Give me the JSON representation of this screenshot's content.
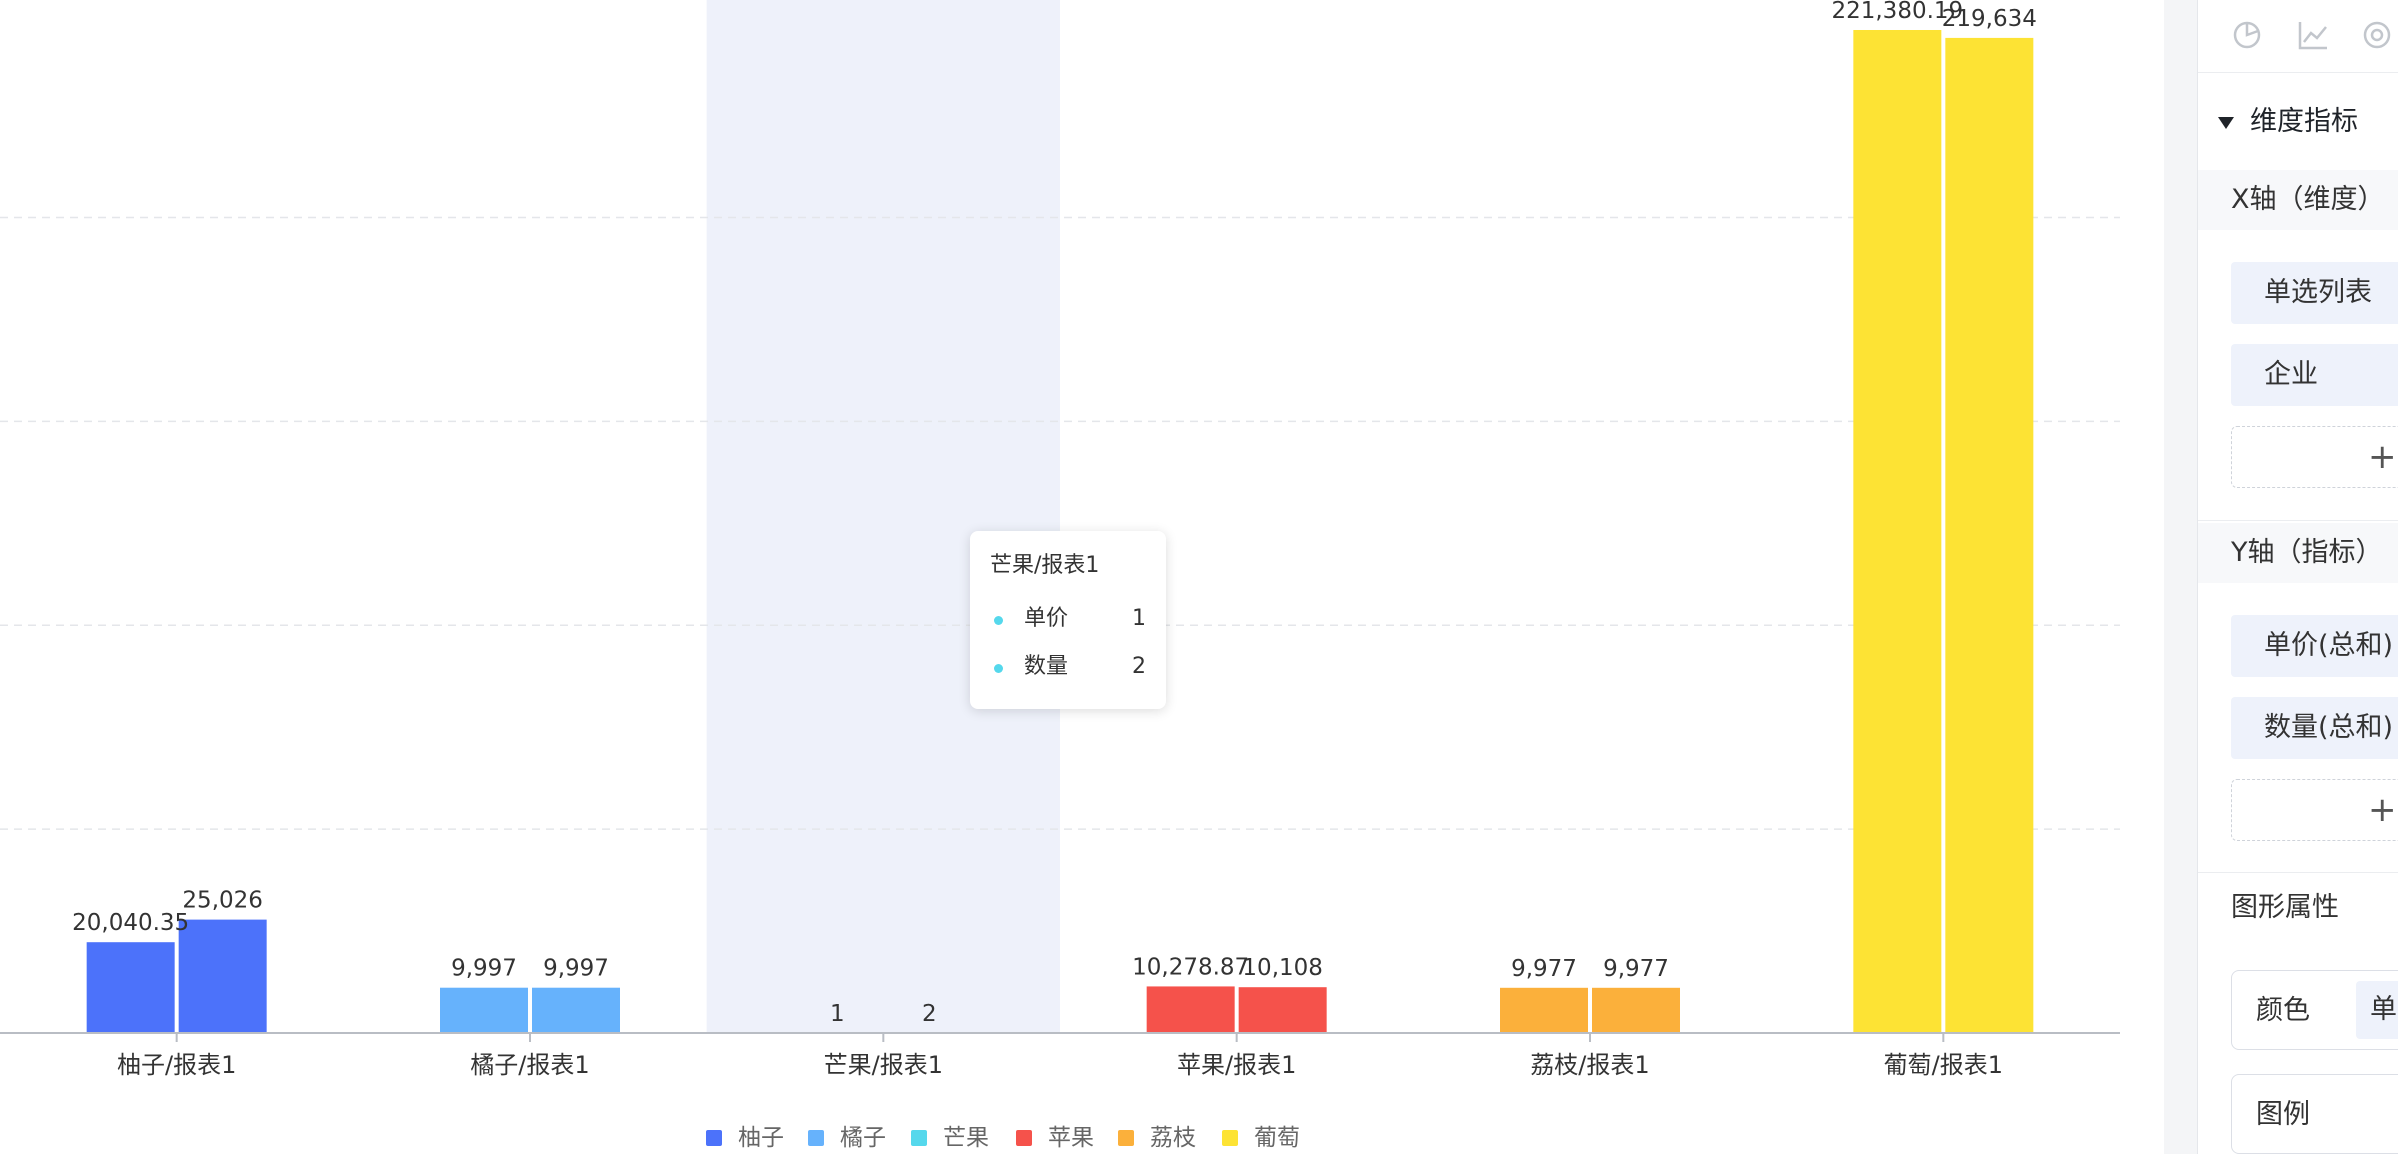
{
  "chart_data": {
    "type": "bar",
    "categories": [
      "柚子/报表1",
      "橘子/报表1",
      "芒果/报表1",
      "苹果/报表1",
      "荔枝/报表1",
      "葡萄/报表1"
    ],
    "series": [
      {
        "name": "单价",
        "values": [
          20040.35,
          9997,
          1,
          10278.87,
          9977,
          221380.19
        ]
      },
      {
        "name": "数量",
        "values": [
          25026,
          9997,
          2,
          10108,
          9977,
          219634
        ]
      }
    ],
    "value_labels": [
      [
        "20,040.35",
        "9,997",
        "1",
        "10,278.87",
        "9,977",
        "221,380.19"
      ],
      [
        "25,026",
        "9,997",
        "2",
        "10,108",
        "9,977",
        "219,634"
      ]
    ],
    "category_colors": [
      "#4c72fa",
      "#66b2fc",
      "#55d8ec",
      "#f5524b",
      "#fbb03b",
      "#fde334"
    ],
    "ylim": [
      0,
      228000
    ],
    "grid": true,
    "highlight_category": "芒果/报表1",
    "highlight_color": "#eef1fa",
    "axis_color": "#b9bdc4",
    "grid_color": "#e4e6ea",
    "legend_position": "bottom-center",
    "legend": [
      {
        "label": "柚子",
        "color": "#4c72fa"
      },
      {
        "label": "橘子",
        "color": "#66b2fc"
      },
      {
        "label": "芒果",
        "color": "#55d8ec"
      },
      {
        "label": "苹果",
        "color": "#f5524b"
      },
      {
        "label": "荔枝",
        "color": "#fbb03b"
      },
      {
        "label": "葡萄",
        "color": "#fde334"
      }
    ]
  },
  "tooltip": {
    "title": "芒果/报表1",
    "dot_color": "#55d8ec",
    "rows": [
      {
        "label": "单价",
        "value": "1"
      },
      {
        "label": "数量",
        "value": "2"
      }
    ]
  },
  "panel": {
    "toolbar_icons": [
      "pie-chart-icon",
      "line-chart-icon",
      "donut-chart-icon"
    ],
    "section_title": "维度指标",
    "x_axis": {
      "title": "X轴（维度）",
      "fields": [
        "单选列表",
        "企业"
      ],
      "add_symbol": "+"
    },
    "y_axis": {
      "title": "Y轴（指标）",
      "fields": [
        "单价(总和)",
        "数量(总和)"
      ],
      "add_symbol": "+"
    },
    "graph_props": {
      "title": "图形属性",
      "color_label": "颜色",
      "color_value": "单",
      "legend_label": "图例"
    }
  }
}
